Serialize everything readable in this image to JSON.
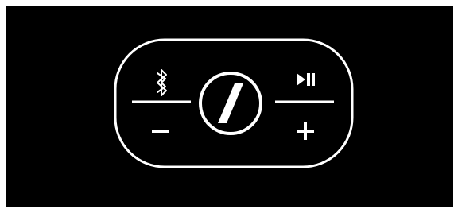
{
  "colors": {
    "page_background": "#ffffff",
    "panel_background": "#000000",
    "stroke": "#ffffff"
  },
  "controls": {
    "bluetooth": {
      "icon": "bluetooth-icon"
    },
    "play_pause": {
      "icon": "play-pause-icon"
    },
    "volume_down": {
      "icon": "minus-icon"
    },
    "volume_up": {
      "icon": "plus-icon"
    },
    "center": {
      "icon": "power-slash-icon"
    }
  }
}
